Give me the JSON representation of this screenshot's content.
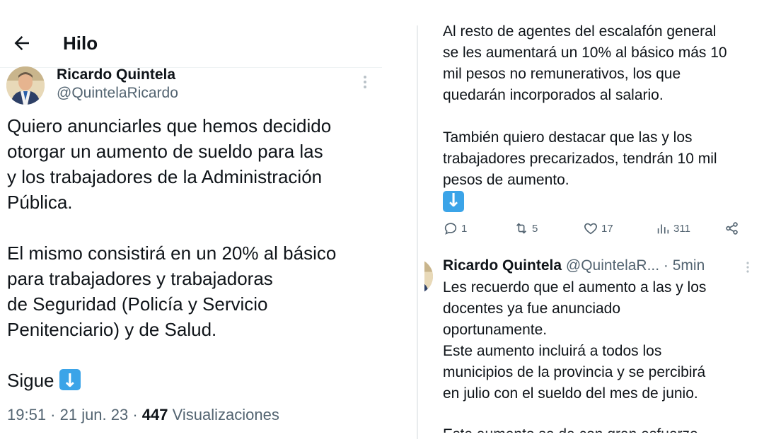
{
  "left": {
    "header": {
      "title": "Hilo"
    },
    "tweet": {
      "author_name": "Ricardo Quintela",
      "author_handle": "@QuintelaRicardo",
      "paragraph_1": "Quiero anunciarles que hemos decidido\notorgar un aumento de sueldo para las\ny los trabajadores de la Administración\nPública.",
      "paragraph_2": "El mismo consistirá en un 20% al básico\npara trabajadores y trabajadoras\nde Seguridad (Policía y Servicio\nPenitenciario) y de Salud.",
      "paragraph_3": "Sigue",
      "emoji_name": "down-arrow-emoji",
      "timestamp": "19:51 · 21 jun. 23 · ",
      "views_count": "447",
      "views_label": " Visualizaciones"
    }
  },
  "right": {
    "tweet_continued": {
      "paragraph_1": "Al resto de agentes del escalafón general\nse les aumentará un 10% al básico más 10\nmil pesos no remunerativos, los que\nquedarán incorporados al salario.",
      "paragraph_2": "También quiero destacar que las y los\ntrabajadores precarizados, tendrán 10 mil\npesos de aumento.",
      "emoji_name": "down-arrow-emoji",
      "actions": {
        "replies": "1",
        "retweets": "5",
        "likes": "17",
        "views": "311"
      }
    },
    "reply": {
      "author_name": "Ricardo Quintela",
      "author_handle": "@QuintelaR...",
      "time": " · 5min",
      "text": "Les recuerdo que el aumento a las y los\ndocentes ya fue anunciado\noportunamente.\nEste aumento incluirá a todos los\nmunicipios de la provincia y se percibirá\nen julio con el sueldo del mes de junio.",
      "cut_off_line": "Este aumento se da con gran esfuerzo"
    }
  },
  "colors": {
    "text_primary": "#0f1419",
    "text_secondary": "#536471",
    "emoji_blue": "#3ba4e8",
    "divider": "#eff3f4"
  }
}
